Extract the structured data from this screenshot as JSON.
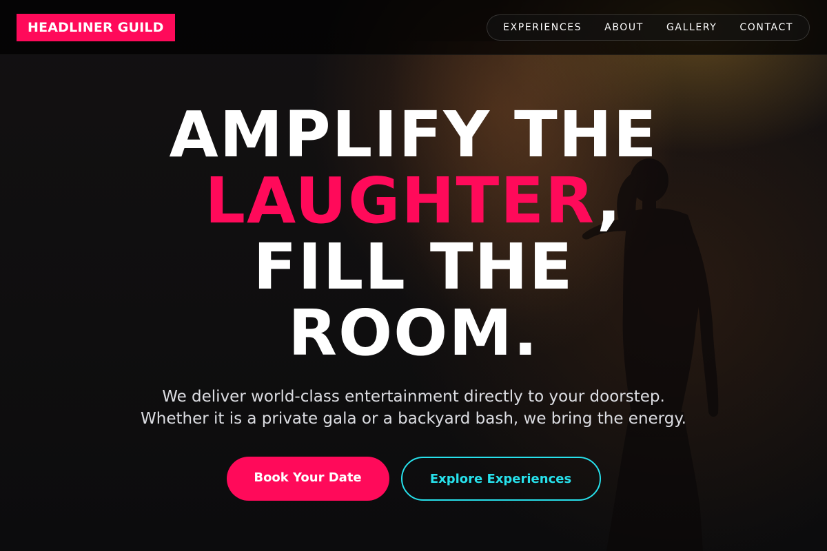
{
  "brand": {
    "name": "HEADLINER GUILD",
    "accent": "#ff0a5a",
    "secondary_accent": "#27e1ec"
  },
  "nav": {
    "items": [
      {
        "label": "EXPERIENCES"
      },
      {
        "label": "ABOUT"
      },
      {
        "label": "GALLERY"
      },
      {
        "label": "CONTACT"
      }
    ]
  },
  "hero": {
    "headline": {
      "line1": "AMPLIFY THE",
      "accent_word": "LAUGHTER",
      "accent_punct": ",",
      "line3": "FILL THE",
      "line4": "ROOM."
    },
    "subtitle": {
      "line1": "We deliver world-class entertainment directly to your doorstep.",
      "line2": "Whether it is a private gala or a backyard bash, we bring the energy."
    },
    "primary_cta": "Book Your Date",
    "secondary_cta": "Explore Experiences",
    "background_image": "performer-silhouette-on-smoky-stage"
  }
}
